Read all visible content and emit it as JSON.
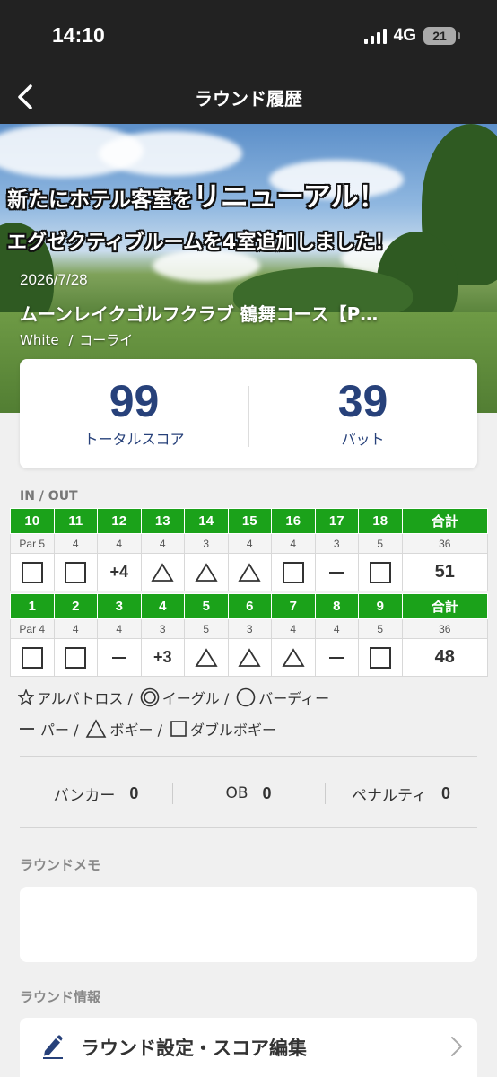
{
  "status_bar": {
    "time": "14:10",
    "network": "4G",
    "battery": "21"
  },
  "nav": {
    "title": "ラウンド履歴",
    "back_icon": "chevron-left-icon"
  },
  "hero": {
    "promo_line1_prefix": "新たにホテル客室を",
    "promo_line1_emphasis": "リニューアル！",
    "promo_line2": "エグゼクティブルームを4室追加しました！",
    "date": "2026/7/28",
    "course_name": "ムーンレイクゴルフクラブ 鶴舞コース【P…",
    "tee": "White",
    "tee_sep": "/",
    "caddie": "コーライ"
  },
  "summary": {
    "total_score": "99",
    "total_score_label": "トータルスコア",
    "putts": "39",
    "putts_label": "パット"
  },
  "scorecard": {
    "section_label": "IN / OUT",
    "halves": [
      {
        "holes": [
          "10",
          "11",
          "12",
          "13",
          "14",
          "15",
          "16",
          "17",
          "18"
        ],
        "total_label": "合計",
        "pars": [
          "Par 5",
          "4",
          "4",
          "4",
          "3",
          "4",
          "4",
          "3",
          "5"
        ],
        "par_total": "36",
        "results": [
          {
            "type": "box"
          },
          {
            "type": "box"
          },
          {
            "type": "text",
            "text": "+4"
          },
          {
            "type": "triangle"
          },
          {
            "type": "triangle"
          },
          {
            "type": "triangle"
          },
          {
            "type": "box"
          },
          {
            "type": "dash"
          },
          {
            "type": "box"
          }
        ],
        "total": "51"
      },
      {
        "holes": [
          "1",
          "2",
          "3",
          "4",
          "5",
          "6",
          "7",
          "8",
          "9"
        ],
        "total_label": "合計",
        "pars": [
          "Par 4",
          "4",
          "4",
          "3",
          "5",
          "3",
          "4",
          "4",
          "5"
        ],
        "par_total": "36",
        "results": [
          {
            "type": "box"
          },
          {
            "type": "box"
          },
          {
            "type": "dash"
          },
          {
            "type": "text",
            "text": "+3"
          },
          {
            "type": "triangle"
          },
          {
            "type": "triangle"
          },
          {
            "type": "triangle"
          },
          {
            "type": "dash"
          },
          {
            "type": "box"
          }
        ],
        "total": "48"
      }
    ]
  },
  "legend": {
    "row1": [
      {
        "icon": "star-icon",
        "label": "アルバトロス /"
      },
      {
        "icon": "double-circle-icon",
        "label": "イーグル /"
      },
      {
        "icon": "circle-icon",
        "label": "バーディー"
      }
    ],
    "row2": [
      {
        "icon": "dash-icon",
        "label": "パー /"
      },
      {
        "icon": "triangle-icon",
        "label": "ボギー /"
      },
      {
        "icon": "square-icon",
        "label": "ダブルボギー"
      }
    ]
  },
  "stats": {
    "bunker_label": "バンカー",
    "bunker_value": "0",
    "ob_label": "OB",
    "ob_value": "0",
    "penalty_label": "ペナルティ",
    "penalty_value": "0"
  },
  "memo": {
    "label": "ラウンドメモ",
    "text": ""
  },
  "info": {
    "label": "ラウンド情報",
    "edit_label": "ラウンド設定・スコア編集",
    "edit_icon": "pencil-icon",
    "chevron_icon": "chevron-right-icon"
  },
  "colors": {
    "hole_header": "#1ba21a",
    "score_blue": "#27417a",
    "edit_icon": "#27417a"
  }
}
